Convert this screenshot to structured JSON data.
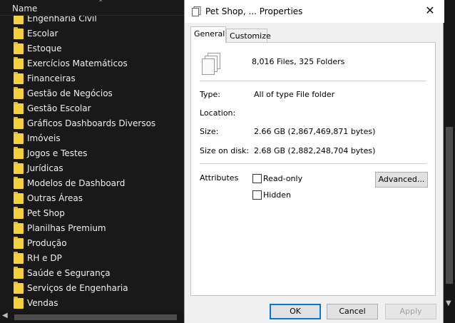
{
  "explorer": {
    "column_header": "Name",
    "folders": [
      "Engenharia Civil",
      "Escolar",
      "Estoque",
      "Exercícios Matemáticos",
      "Financeiras",
      "Gestão de Negócios",
      "Gestão Escolar",
      "Gráficos Dashboards Diversos",
      "Imóveis",
      "Jogos e Testes",
      "Jurídicas",
      "Modelos de Dashboard",
      "Outras Áreas",
      "Pet Shop",
      "Planilhas Premium",
      "Produção",
      "RH e DP",
      "Saúde e Segurança",
      "Serviços de Engenharia",
      "Vendas"
    ]
  },
  "dialog": {
    "title": "Pet Shop, ... Properties",
    "tabs": [
      "General",
      "Customize"
    ],
    "summary": "8,016 Files, 325 Folders",
    "type_label": "Type:",
    "type_value": "All of type File folder",
    "location_label": "Location:",
    "location_value": "",
    "size_label": "Size:",
    "size_value": "2.66 GB (2,867,469,871 bytes)",
    "size_on_disk_label": "Size on disk:",
    "size_on_disk_value": "2.68 GB (2,882,248,704 bytes)",
    "attributes_label": "Attributes",
    "readonly_label": "Read-only",
    "hidden_label": "Hidden",
    "advanced_label": "Advanced...",
    "ok_label": "OK",
    "cancel_label": "Cancel",
    "apply_label": "Apply",
    "close_glyph": "✕"
  },
  "colors": {
    "explorer_bg": "#191919",
    "folder_yellow": "#f4d03f",
    "ok_border": "#0078d7"
  }
}
